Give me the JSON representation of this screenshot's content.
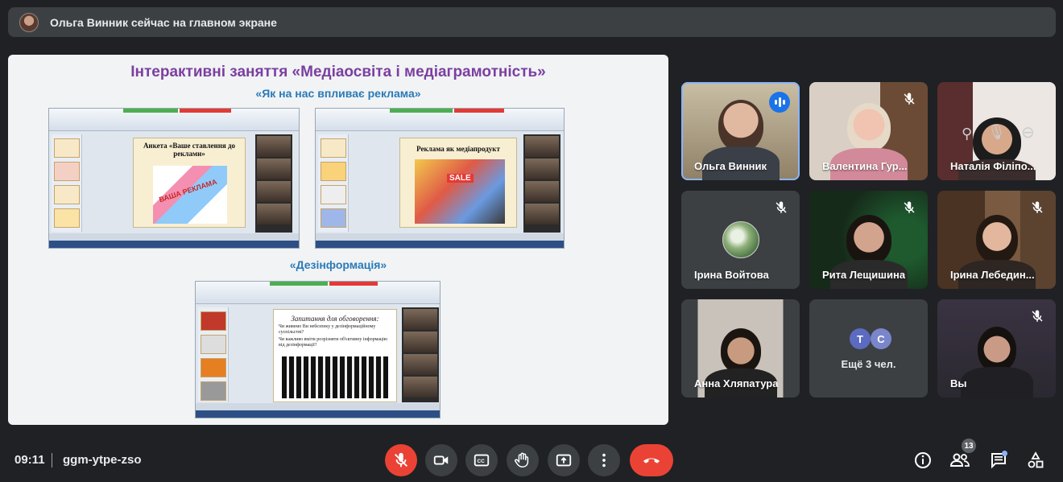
{
  "banner": {
    "text": "Ольга Винник сейчас на главном экране"
  },
  "slide": {
    "title": "Інтерактивні заняття «Медіаосвіта і медіаграмотність»",
    "subtitle1": "«Як на нас впливає реклама»",
    "subtitle2": "«Дезінформація»",
    "shot1_title": "Анкета «Ваше ставлення до реклами»",
    "shot1_poster": "ВАША РЕКЛАМА",
    "shot2_title": "Реклама як медіапродукт",
    "shot2_sale": "SALE",
    "shot3_title": "Запитання для обговорення:",
    "shot3_q1": "Чи живемо Ви небезпеку у дезінформаційному суспільстві?",
    "shot3_q2": "Чи важливо вміти розрізняти об'єктивну інформацію від дезінформації?"
  },
  "participants": [
    {
      "name": "Ольга Винник"
    },
    {
      "name": "Валентина Гур..."
    },
    {
      "name": "Наталія Філіпо..."
    },
    {
      "name": "Ірина Войтова"
    },
    {
      "name": "Рита Лещишина"
    },
    {
      "name": "Ірина Лебедин..."
    },
    {
      "name": "Анна Хляпатура"
    },
    {
      "name": "Ещё 3 чел.",
      "avatars": [
        "Т",
        "С"
      ]
    },
    {
      "name": "Вы"
    }
  ],
  "colors": {
    "accent": "#8ab4f8",
    "danger": "#ea4335",
    "speaking": "#1a73e8",
    "avatar_t": "#5c6bc0",
    "avatar_c": "#7986cb"
  },
  "meeting": {
    "time": "09:11",
    "code": "ggm-ytpe-zso",
    "people_count": "13"
  }
}
